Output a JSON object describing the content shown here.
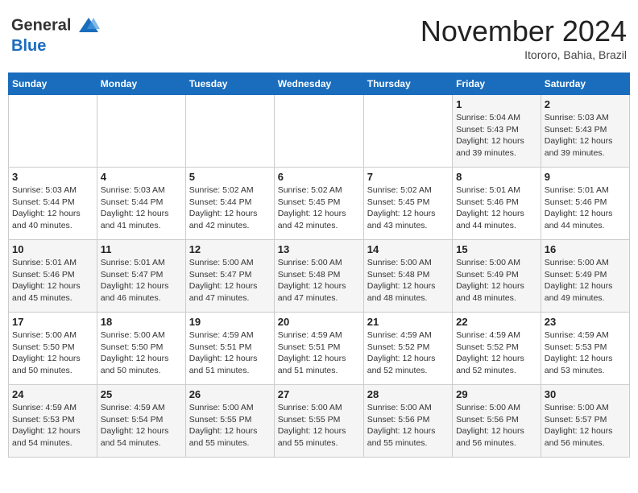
{
  "header": {
    "logo_line1": "General",
    "logo_line2": "Blue",
    "month": "November 2024",
    "location": "Itororo, Bahia, Brazil"
  },
  "weekdays": [
    "Sunday",
    "Monday",
    "Tuesday",
    "Wednesday",
    "Thursday",
    "Friday",
    "Saturday"
  ],
  "weeks": [
    [
      {
        "day": "",
        "info": ""
      },
      {
        "day": "",
        "info": ""
      },
      {
        "day": "",
        "info": ""
      },
      {
        "day": "",
        "info": ""
      },
      {
        "day": "",
        "info": ""
      },
      {
        "day": "1",
        "info": "Sunrise: 5:04 AM\nSunset: 5:43 PM\nDaylight: 12 hours and 39 minutes."
      },
      {
        "day": "2",
        "info": "Sunrise: 5:03 AM\nSunset: 5:43 PM\nDaylight: 12 hours and 39 minutes."
      }
    ],
    [
      {
        "day": "3",
        "info": "Sunrise: 5:03 AM\nSunset: 5:44 PM\nDaylight: 12 hours and 40 minutes."
      },
      {
        "day": "4",
        "info": "Sunrise: 5:03 AM\nSunset: 5:44 PM\nDaylight: 12 hours and 41 minutes."
      },
      {
        "day": "5",
        "info": "Sunrise: 5:02 AM\nSunset: 5:44 PM\nDaylight: 12 hours and 42 minutes."
      },
      {
        "day": "6",
        "info": "Sunrise: 5:02 AM\nSunset: 5:45 PM\nDaylight: 12 hours and 42 minutes."
      },
      {
        "day": "7",
        "info": "Sunrise: 5:02 AM\nSunset: 5:45 PM\nDaylight: 12 hours and 43 minutes."
      },
      {
        "day": "8",
        "info": "Sunrise: 5:01 AM\nSunset: 5:46 PM\nDaylight: 12 hours and 44 minutes."
      },
      {
        "day": "9",
        "info": "Sunrise: 5:01 AM\nSunset: 5:46 PM\nDaylight: 12 hours and 44 minutes."
      }
    ],
    [
      {
        "day": "10",
        "info": "Sunrise: 5:01 AM\nSunset: 5:46 PM\nDaylight: 12 hours and 45 minutes."
      },
      {
        "day": "11",
        "info": "Sunrise: 5:01 AM\nSunset: 5:47 PM\nDaylight: 12 hours and 46 minutes."
      },
      {
        "day": "12",
        "info": "Sunrise: 5:00 AM\nSunset: 5:47 PM\nDaylight: 12 hours and 47 minutes."
      },
      {
        "day": "13",
        "info": "Sunrise: 5:00 AM\nSunset: 5:48 PM\nDaylight: 12 hours and 47 minutes."
      },
      {
        "day": "14",
        "info": "Sunrise: 5:00 AM\nSunset: 5:48 PM\nDaylight: 12 hours and 48 minutes."
      },
      {
        "day": "15",
        "info": "Sunrise: 5:00 AM\nSunset: 5:49 PM\nDaylight: 12 hours and 48 minutes."
      },
      {
        "day": "16",
        "info": "Sunrise: 5:00 AM\nSunset: 5:49 PM\nDaylight: 12 hours and 49 minutes."
      }
    ],
    [
      {
        "day": "17",
        "info": "Sunrise: 5:00 AM\nSunset: 5:50 PM\nDaylight: 12 hours and 50 minutes."
      },
      {
        "day": "18",
        "info": "Sunrise: 5:00 AM\nSunset: 5:50 PM\nDaylight: 12 hours and 50 minutes."
      },
      {
        "day": "19",
        "info": "Sunrise: 4:59 AM\nSunset: 5:51 PM\nDaylight: 12 hours and 51 minutes."
      },
      {
        "day": "20",
        "info": "Sunrise: 4:59 AM\nSunset: 5:51 PM\nDaylight: 12 hours and 51 minutes."
      },
      {
        "day": "21",
        "info": "Sunrise: 4:59 AM\nSunset: 5:52 PM\nDaylight: 12 hours and 52 minutes."
      },
      {
        "day": "22",
        "info": "Sunrise: 4:59 AM\nSunset: 5:52 PM\nDaylight: 12 hours and 52 minutes."
      },
      {
        "day": "23",
        "info": "Sunrise: 4:59 AM\nSunset: 5:53 PM\nDaylight: 12 hours and 53 minutes."
      }
    ],
    [
      {
        "day": "24",
        "info": "Sunrise: 4:59 AM\nSunset: 5:53 PM\nDaylight: 12 hours and 54 minutes."
      },
      {
        "day": "25",
        "info": "Sunrise: 4:59 AM\nSunset: 5:54 PM\nDaylight: 12 hours and 54 minutes."
      },
      {
        "day": "26",
        "info": "Sunrise: 5:00 AM\nSunset: 5:55 PM\nDaylight: 12 hours and 55 minutes."
      },
      {
        "day": "27",
        "info": "Sunrise: 5:00 AM\nSunset: 5:55 PM\nDaylight: 12 hours and 55 minutes."
      },
      {
        "day": "28",
        "info": "Sunrise: 5:00 AM\nSunset: 5:56 PM\nDaylight: 12 hours and 55 minutes."
      },
      {
        "day": "29",
        "info": "Sunrise: 5:00 AM\nSunset: 5:56 PM\nDaylight: 12 hours and 56 minutes."
      },
      {
        "day": "30",
        "info": "Sunrise: 5:00 AM\nSunset: 5:57 PM\nDaylight: 12 hours and 56 minutes."
      }
    ]
  ]
}
